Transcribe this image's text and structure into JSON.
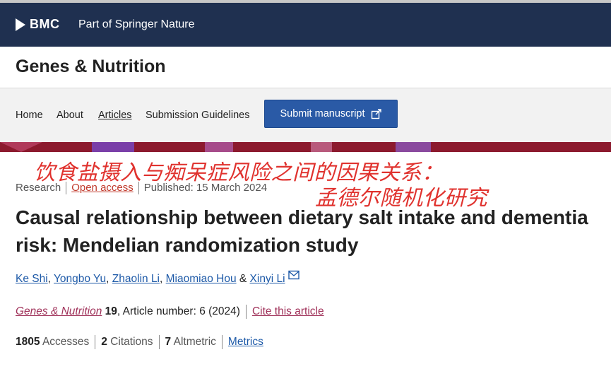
{
  "brand": {
    "logo_text": "BMC",
    "tagline": "Part of Springer Nature"
  },
  "journal": {
    "title": "Genes & Nutrition"
  },
  "nav": {
    "items": [
      {
        "label": "Home"
      },
      {
        "label": "About"
      },
      {
        "label": "Articles"
      },
      {
        "label": "Submission Guidelines"
      }
    ],
    "submit_label": "Submit manuscript"
  },
  "overlay": {
    "line1": "饮食盐摄入与痴呆症风险之间的因果关系：",
    "line2": "孟德尔随机化研究"
  },
  "article": {
    "type": "Research",
    "access": "Open access",
    "published": "Published: 15 March 2024",
    "title": "Causal relationship between dietary salt intake and dementia risk: Mendelian randomization study",
    "authors": [
      "Ke Shi",
      "Yongbo Yu",
      "Zhaolin Li",
      "Miaomiao Hou",
      "Xinyi Li"
    ],
    "author_sep": ",",
    "author_and": "&",
    "citation": {
      "journal": "Genes & Nutrition",
      "volume": "19",
      "article_number": ", Article number: 6 (2024)",
      "cite_label": "Cite this article"
    },
    "metrics": {
      "accesses_count": "1805",
      "accesses_label": "Accesses",
      "citations_count": "2",
      "citations_label": "Citations",
      "altmetric_count": "7",
      "altmetric_label": "Altmetric",
      "metrics_link": "Metrics"
    }
  },
  "colors": {
    "brand_bar": "#1f3050",
    "submit_button": "#2a5aa6",
    "overlay_text": "#e0322e",
    "link": "#1e5aa8",
    "journal_link": "#a0325a",
    "accent_band": "#8c1a2e"
  }
}
